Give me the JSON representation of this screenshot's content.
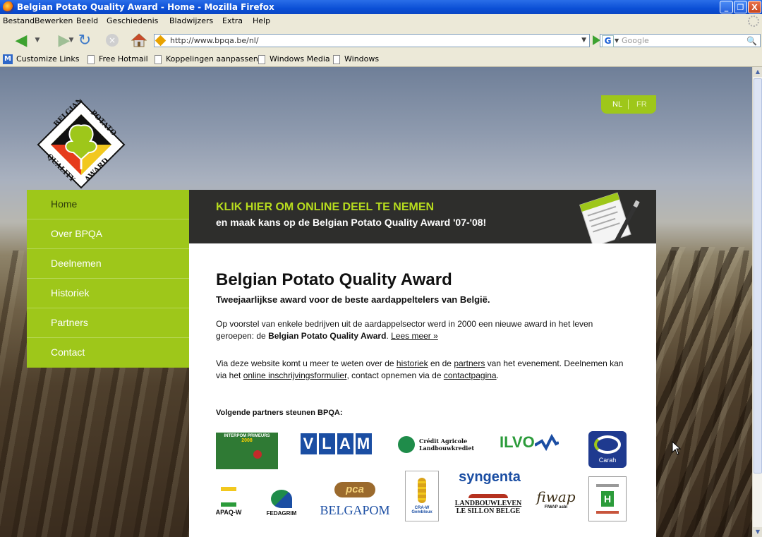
{
  "browser": {
    "title": "Belgian Potato Quality Award - Home - Mozilla Firefox",
    "menu": [
      "Bestand",
      "Bewerken",
      "Beeld",
      "Geschiedenis",
      "Bladwijzers",
      "Extra",
      "Help"
    ],
    "url": "http://www.bpqa.be/nl/",
    "search_placeholder": "Google",
    "search_engine_glyph": "G",
    "bookmarks": [
      "Customize Links",
      "Free Hotmail",
      "Koppelingen aanpassen",
      "Windows Media",
      "Windows"
    ],
    "window_buttons": {
      "minimize": "_",
      "maximize": "❐",
      "close": "X"
    }
  },
  "page": {
    "lang": {
      "nl": "NL",
      "fr": "FR"
    },
    "nav": [
      "Home",
      "Over BPQA",
      "Deelnemen",
      "Historiek",
      "Partners",
      "Contact"
    ],
    "banner": {
      "line1": "KLIK HIER OM ONLINE DEEL TE NEMEN",
      "line2": "en maak kans op de Belgian Potato Quality Award '07-'08!"
    },
    "title": "Belgian Potato Quality Award",
    "subtitle": "Tweejaarlijkse award voor de beste aardappeltelers van België.",
    "p1": {
      "text_before": "Op voorstel van enkele bedrijven uit de aardappelsector werd in 2000 een nieuwe award in het leven geroepen: de ",
      "bold": "Belgian Potato Quality Award",
      "text_after": ". ",
      "link": "Lees meer »"
    },
    "p2": {
      "t1": "Via deze website komt u meer te weten over de ",
      "l1": "historiek",
      "t2": " en de ",
      "l2": "partners",
      "t3": " van het evenement. Deelnemen kan via het ",
      "l3": "online inschrijvingsformulier",
      "t4": ", contact opnemen via de ",
      "l4": "contactpagina",
      "t5": "."
    },
    "partners_title": "Volgende partners steunen BPQA:",
    "logo_text": {
      "belgian": "BELGIAN",
      "potato": "POTATO",
      "quality": "QUALITY",
      "award": "AWARD"
    },
    "partners": {
      "interpom": "INTERPOM PRIMEURS",
      "interpom_year": "2008",
      "vlam": [
        "V",
        "L",
        "A",
        "M"
      ],
      "credit": "Crédit Agricole",
      "credit2": "Landbouwkrediet",
      "ilvo": "ILVO",
      "carah": "Carah",
      "apaq": "APAQ-W",
      "fedagrim": "FEDAGRIM",
      "pca": "pca",
      "belgapom": "BELGAPOM",
      "cra": "CRA-W",
      "cra2": "Gembloux",
      "syngenta": "syngenta",
      "landbouwleven": "LANDBOUWLEVEN",
      "sillon": "LE SILLON BELGE",
      "fiwap": "fiwap",
      "fiwap2": "FIWAP asbl"
    },
    "colors": {
      "accent": "#9ec71a",
      "banner": "#2e2e2c",
      "banner_highlight": "#b7dc1e"
    }
  }
}
